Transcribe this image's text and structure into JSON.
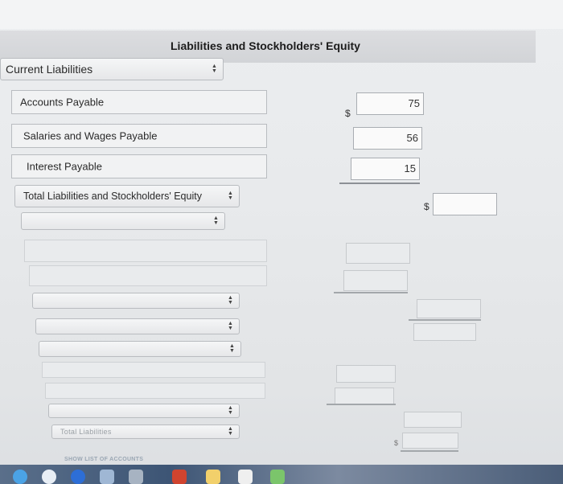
{
  "header": {
    "title": "Liabilities and Stockholders' Equity"
  },
  "section_select": {
    "label": "Current Liabilities"
  },
  "rows": [
    {
      "label": "Accounts Payable",
      "value": "75",
      "currency": "$"
    },
    {
      "label": "Salaries and Wages Payable",
      "value": "56"
    },
    {
      "label": "Interest Payable",
      "value": "15"
    }
  ],
  "total_select": {
    "label": "Total Liabilities and Stockholders' Equity",
    "currency": "$"
  },
  "footer": {
    "faint_label": "Total Liabilities",
    "faint_currency": "$",
    "show_accounts": "SHOW LIST OF ACCOUNTS"
  }
}
